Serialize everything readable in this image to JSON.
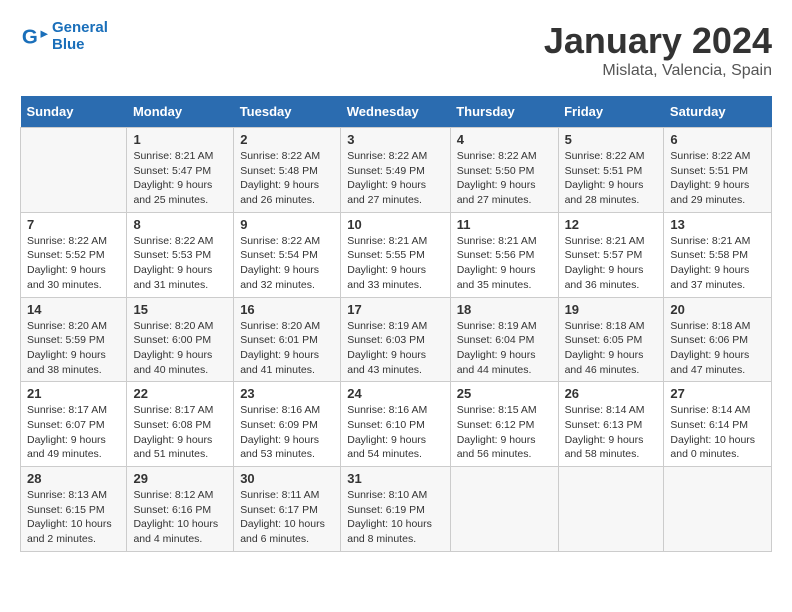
{
  "logo": {
    "line1": "General",
    "line2": "Blue"
  },
  "title": "January 2024",
  "subtitle": "Mislata, Valencia, Spain",
  "weekdays": [
    "Sunday",
    "Monday",
    "Tuesday",
    "Wednesday",
    "Thursday",
    "Friday",
    "Saturday"
  ],
  "weeks": [
    [
      {
        "num": "",
        "info": ""
      },
      {
        "num": "1",
        "info": "Sunrise: 8:21 AM\nSunset: 5:47 PM\nDaylight: 9 hours\nand 25 minutes."
      },
      {
        "num": "2",
        "info": "Sunrise: 8:22 AM\nSunset: 5:48 PM\nDaylight: 9 hours\nand 26 minutes."
      },
      {
        "num": "3",
        "info": "Sunrise: 8:22 AM\nSunset: 5:49 PM\nDaylight: 9 hours\nand 27 minutes."
      },
      {
        "num": "4",
        "info": "Sunrise: 8:22 AM\nSunset: 5:50 PM\nDaylight: 9 hours\nand 27 minutes."
      },
      {
        "num": "5",
        "info": "Sunrise: 8:22 AM\nSunset: 5:51 PM\nDaylight: 9 hours\nand 28 minutes."
      },
      {
        "num": "6",
        "info": "Sunrise: 8:22 AM\nSunset: 5:51 PM\nDaylight: 9 hours\nand 29 minutes."
      }
    ],
    [
      {
        "num": "7",
        "info": "Sunrise: 8:22 AM\nSunset: 5:52 PM\nDaylight: 9 hours\nand 30 minutes."
      },
      {
        "num": "8",
        "info": "Sunrise: 8:22 AM\nSunset: 5:53 PM\nDaylight: 9 hours\nand 31 minutes."
      },
      {
        "num": "9",
        "info": "Sunrise: 8:22 AM\nSunset: 5:54 PM\nDaylight: 9 hours\nand 32 minutes."
      },
      {
        "num": "10",
        "info": "Sunrise: 8:21 AM\nSunset: 5:55 PM\nDaylight: 9 hours\nand 33 minutes."
      },
      {
        "num": "11",
        "info": "Sunrise: 8:21 AM\nSunset: 5:56 PM\nDaylight: 9 hours\nand 35 minutes."
      },
      {
        "num": "12",
        "info": "Sunrise: 8:21 AM\nSunset: 5:57 PM\nDaylight: 9 hours\nand 36 minutes."
      },
      {
        "num": "13",
        "info": "Sunrise: 8:21 AM\nSunset: 5:58 PM\nDaylight: 9 hours\nand 37 minutes."
      }
    ],
    [
      {
        "num": "14",
        "info": "Sunrise: 8:20 AM\nSunset: 5:59 PM\nDaylight: 9 hours\nand 38 minutes."
      },
      {
        "num": "15",
        "info": "Sunrise: 8:20 AM\nSunset: 6:00 PM\nDaylight: 9 hours\nand 40 minutes."
      },
      {
        "num": "16",
        "info": "Sunrise: 8:20 AM\nSunset: 6:01 PM\nDaylight: 9 hours\nand 41 minutes."
      },
      {
        "num": "17",
        "info": "Sunrise: 8:19 AM\nSunset: 6:03 PM\nDaylight: 9 hours\nand 43 minutes."
      },
      {
        "num": "18",
        "info": "Sunrise: 8:19 AM\nSunset: 6:04 PM\nDaylight: 9 hours\nand 44 minutes."
      },
      {
        "num": "19",
        "info": "Sunrise: 8:18 AM\nSunset: 6:05 PM\nDaylight: 9 hours\nand 46 minutes."
      },
      {
        "num": "20",
        "info": "Sunrise: 8:18 AM\nSunset: 6:06 PM\nDaylight: 9 hours\nand 47 minutes."
      }
    ],
    [
      {
        "num": "21",
        "info": "Sunrise: 8:17 AM\nSunset: 6:07 PM\nDaylight: 9 hours\nand 49 minutes."
      },
      {
        "num": "22",
        "info": "Sunrise: 8:17 AM\nSunset: 6:08 PM\nDaylight: 9 hours\nand 51 minutes."
      },
      {
        "num": "23",
        "info": "Sunrise: 8:16 AM\nSunset: 6:09 PM\nDaylight: 9 hours\nand 53 minutes."
      },
      {
        "num": "24",
        "info": "Sunrise: 8:16 AM\nSunset: 6:10 PM\nDaylight: 9 hours\nand 54 minutes."
      },
      {
        "num": "25",
        "info": "Sunrise: 8:15 AM\nSunset: 6:12 PM\nDaylight: 9 hours\nand 56 minutes."
      },
      {
        "num": "26",
        "info": "Sunrise: 8:14 AM\nSunset: 6:13 PM\nDaylight: 9 hours\nand 58 minutes."
      },
      {
        "num": "27",
        "info": "Sunrise: 8:14 AM\nSunset: 6:14 PM\nDaylight: 10 hours\nand 0 minutes."
      }
    ],
    [
      {
        "num": "28",
        "info": "Sunrise: 8:13 AM\nSunset: 6:15 PM\nDaylight: 10 hours\nand 2 minutes."
      },
      {
        "num": "29",
        "info": "Sunrise: 8:12 AM\nSunset: 6:16 PM\nDaylight: 10 hours\nand 4 minutes."
      },
      {
        "num": "30",
        "info": "Sunrise: 8:11 AM\nSunset: 6:17 PM\nDaylight: 10 hours\nand 6 minutes."
      },
      {
        "num": "31",
        "info": "Sunrise: 8:10 AM\nSunset: 6:19 PM\nDaylight: 10 hours\nand 8 minutes."
      },
      {
        "num": "",
        "info": ""
      },
      {
        "num": "",
        "info": ""
      },
      {
        "num": "",
        "info": ""
      }
    ]
  ]
}
